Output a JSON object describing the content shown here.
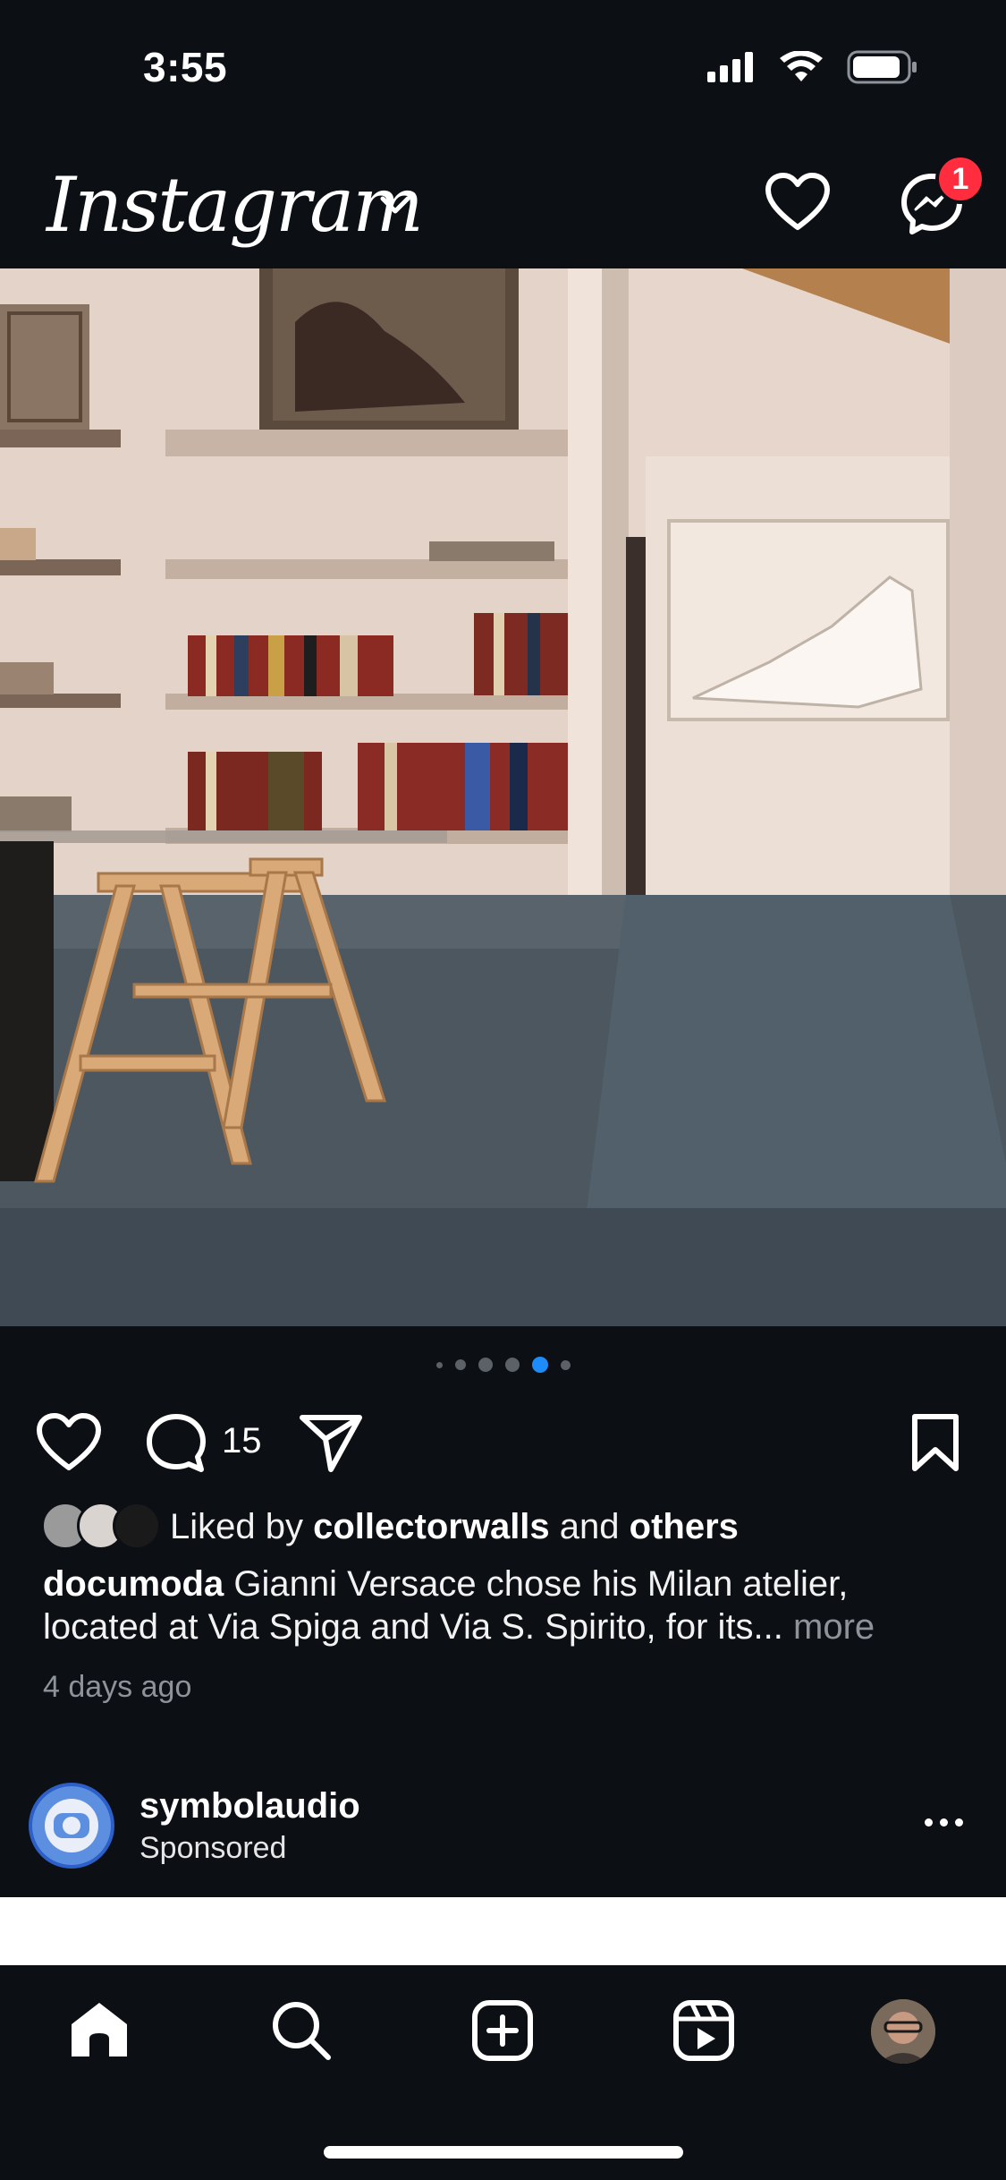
{
  "status_bar": {
    "time": "3:55"
  },
  "header": {
    "logo_text": "Instagram",
    "notification_badge": "1"
  },
  "carousel": {
    "dot_count": 6,
    "active_index": 4
  },
  "post": {
    "comment_count": "15",
    "liked_prefix": "Liked by ",
    "liked_user": "collectorwalls",
    "liked_and": " and ",
    "liked_others": "others",
    "caption_user": "documoda",
    "caption_text": " Gianni Versace chose his Milan atelier, located at Via Spiga and Via S. Spirito, for its...",
    "more_label": " more",
    "time_ago": "4 days ago"
  },
  "next_post": {
    "username": "symbolaudio",
    "subtitle": "Sponsored"
  },
  "colors": {
    "background": "#0c0f14",
    "badge": "#ff2d3d",
    "active_dot": "#1d8cf8",
    "secondary_text": "#8e939a"
  },
  "tabs": [
    "home-icon",
    "search-icon",
    "create-icon",
    "reels-icon",
    "profile-avatar"
  ]
}
